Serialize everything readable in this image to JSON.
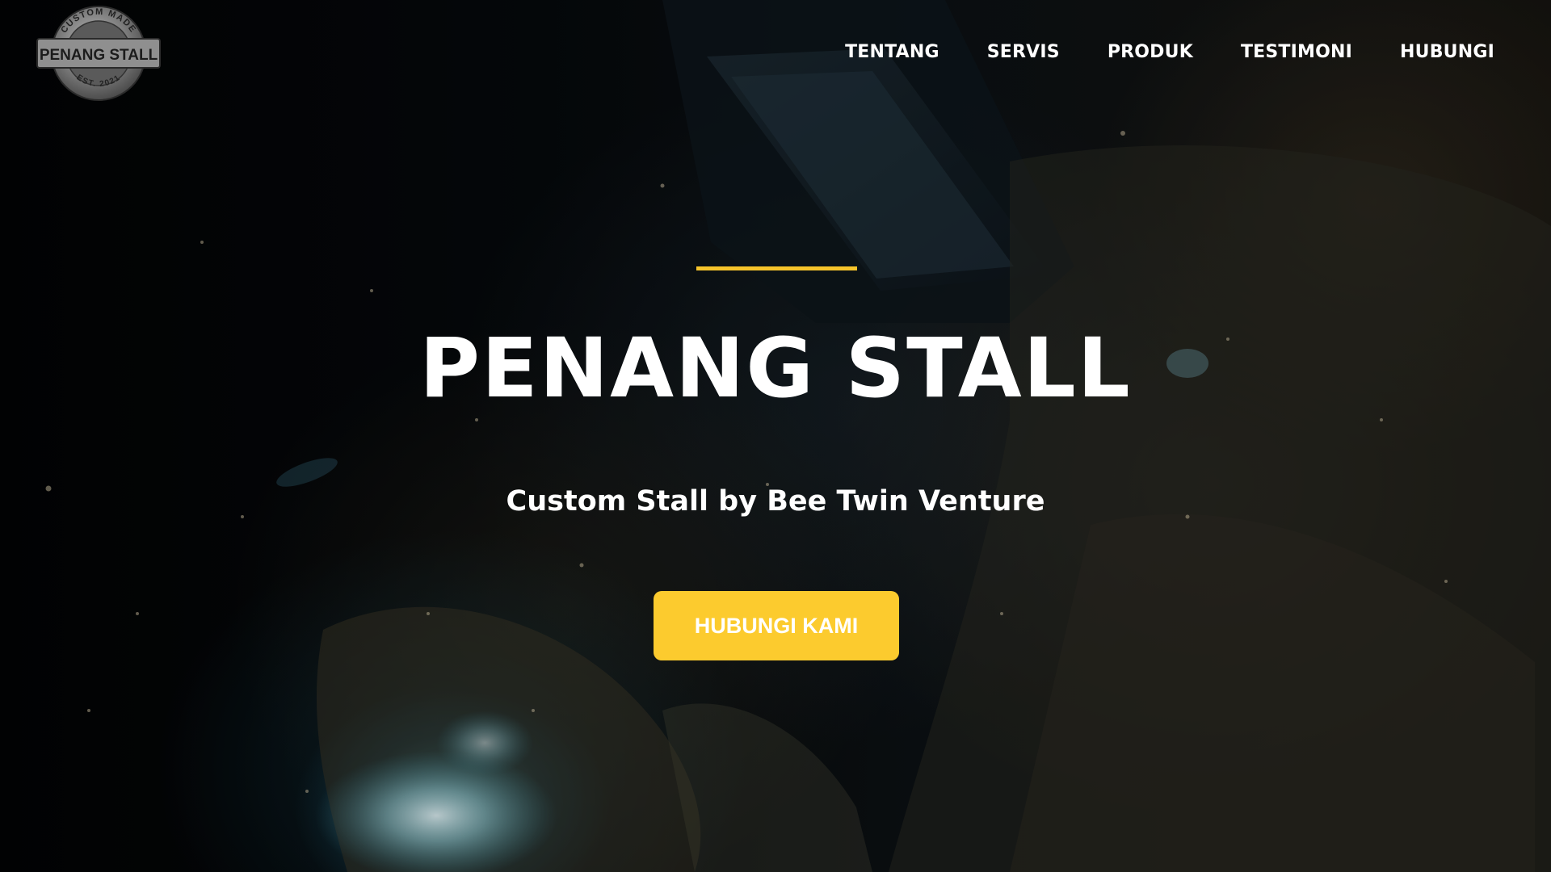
{
  "logo": {
    "top_text": "CUSTOM MADE",
    "main_text": "PENANG STALL",
    "bottom_text": "EST. 2021"
  },
  "nav": {
    "items": [
      {
        "label": "TENTANG"
      },
      {
        "label": "SERVIS"
      },
      {
        "label": "PRODUK"
      },
      {
        "label": "TESTIMONI"
      },
      {
        "label": "HUBUNGI"
      }
    ]
  },
  "hero": {
    "title": "PENANG STALL",
    "subtitle": "Custom Stall by Bee Twin Venture",
    "cta_label": "HUBUNGI KAMI"
  },
  "colors": {
    "accent": "#f6c42b",
    "button": "#fccb2e",
    "text": "#ffffff",
    "background": "#05080c"
  }
}
